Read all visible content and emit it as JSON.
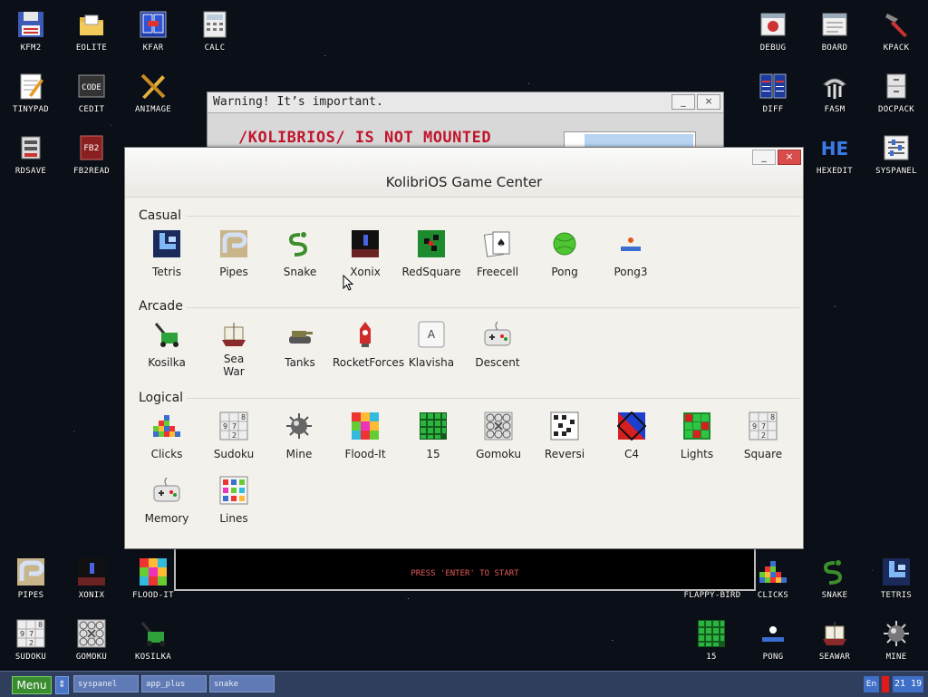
{
  "desktop": {
    "icons": [
      {
        "label": "KFM2",
        "icon": "floppy-disk-icon"
      },
      {
        "label": "EOLITE",
        "icon": "folder-icon"
      },
      {
        "label": "KFAR",
        "icon": "blue-panels-icon"
      },
      {
        "label": "CALC",
        "icon": "calculator-icon"
      },
      {
        "label": "TINYPAD",
        "icon": "notepad-icon"
      },
      {
        "label": "CEDIT",
        "icon": "code-editor-icon"
      },
      {
        "label": "ANIMAGE",
        "icon": "pencil-cross-icon"
      },
      {
        "label": "RDSAVE",
        "icon": "ramdisk-save-icon"
      },
      {
        "label": "FB2READ",
        "icon": "book-icon"
      },
      {
        "label": "DEBUG",
        "icon": "bug-window-icon"
      },
      {
        "label": "BOARD",
        "icon": "board-window-icon"
      },
      {
        "label": "KPACK",
        "icon": "hammer-icon"
      },
      {
        "label": "DIFF",
        "icon": "diff-icon"
      },
      {
        "label": "FASM",
        "icon": "assembler-icon"
      },
      {
        "label": "DOCPACK",
        "icon": "cabinet-icon"
      },
      {
        "label": "HEXEDIT",
        "icon": "hex-editor-icon"
      },
      {
        "label": "SYSPANEL",
        "icon": "sliders-icon"
      },
      {
        "label": "PIPES",
        "icon": "pipes-icon"
      },
      {
        "label": "XONIX",
        "icon": "xonix-icon"
      },
      {
        "label": "FLOOD-IT",
        "icon": "flood-it-icon"
      },
      {
        "label": "SUDOKU",
        "icon": "sudoku-icon"
      },
      {
        "label": "GOMOKU",
        "icon": "gomoku-icon"
      },
      {
        "label": "KOSILKA",
        "icon": "lawnmower-icon"
      },
      {
        "label": "FLAPPY-BIRD",
        "icon": "flappy-bird-icon"
      },
      {
        "label": "CLICKS",
        "icon": "clicks-icon"
      },
      {
        "label": "SNAKE",
        "icon": "snake-icon"
      },
      {
        "label": "TETRIS",
        "icon": "tetris-icon"
      },
      {
        "label": "15",
        "icon": "fifteen-icon"
      },
      {
        "label": "PONG",
        "icon": "pong-icon"
      },
      {
        "label": "SEAWAR",
        "icon": "ship-icon"
      },
      {
        "label": "MINE",
        "icon": "mine-icon"
      }
    ]
  },
  "warning_window": {
    "title": "Warning! It’s important.",
    "message": "/KOLIBRIOS/ IS NOT MOUNTED"
  },
  "snake_window": {
    "prompt": "PRESS 'ENTER' TO START"
  },
  "game_center": {
    "title": "KolibriOS Game Center",
    "minimize": "_",
    "close": "×",
    "sections": [
      {
        "name": "Casual",
        "games": [
          {
            "label": "Tetris",
            "icon": "tetris-icon"
          },
          {
            "label": "Pipes",
            "icon": "pipes-icon"
          },
          {
            "label": "Snake",
            "icon": "snake-icon"
          },
          {
            "label": "Xonix",
            "icon": "xonix-icon"
          },
          {
            "label": "RedSquare",
            "icon": "redsquare-icon"
          },
          {
            "label": "Freecell",
            "icon": "cards-icon"
          },
          {
            "label": "Pong",
            "icon": "ball-icon"
          },
          {
            "label": "Pong3",
            "icon": "paddle-icon"
          }
        ]
      },
      {
        "name": "Arcade",
        "games": [
          {
            "label": "Kosilka",
            "icon": "lawnmower-icon"
          },
          {
            "label": "Sea War",
            "icon": "ship-icon"
          },
          {
            "label": "Tanks",
            "icon": "tank-icon"
          },
          {
            "label": "RocketForces",
            "icon": "rocket-icon"
          },
          {
            "label": "Klavisha",
            "icon": "key-a-icon"
          },
          {
            "label": "Descent",
            "icon": "gamepad-icon"
          }
        ]
      },
      {
        "name": "Logical",
        "games": [
          {
            "label": "Clicks",
            "icon": "clicks-icon"
          },
          {
            "label": "Sudoku",
            "icon": "sudoku-icon"
          },
          {
            "label": "Mine",
            "icon": "mine-icon"
          },
          {
            "label": "Flood-It",
            "icon": "flood-it-icon"
          },
          {
            "label": "15",
            "icon": "fifteen-icon"
          },
          {
            "label": "Gomoku",
            "icon": "gomoku-icon"
          },
          {
            "label": "Reversi",
            "icon": "reversi-icon"
          },
          {
            "label": "C4",
            "icon": "c4-icon"
          },
          {
            "label": "Lights",
            "icon": "lights-icon"
          },
          {
            "label": "Square",
            "icon": "square-icon"
          },
          {
            "label": "Memory",
            "icon": "gamepad-icon"
          },
          {
            "label": "Lines",
            "icon": "lines-icon"
          }
        ]
      }
    ]
  },
  "taskbar": {
    "menu": "Menu",
    "switch": "⇕",
    "tasks": [
      "syspanel",
      "app_plus",
      "snake"
    ],
    "lang": "En",
    "clock": "21 19"
  },
  "colors": {
    "desktop_bg": "#0b1018",
    "taskbar": "#2f3e5c",
    "menu_green": "#3a8c2f",
    "warning_red": "#c0152b",
    "close_red": "#d94c4c"
  }
}
